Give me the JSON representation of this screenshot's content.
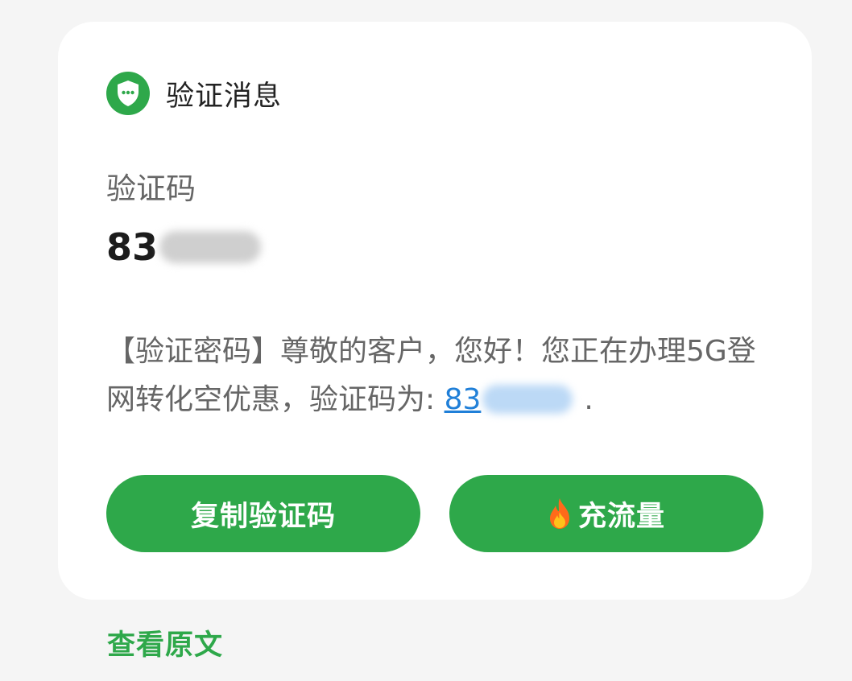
{
  "header": {
    "icon": "shield-chat-icon",
    "title": "验证消息"
  },
  "code": {
    "label": "验证码",
    "value_visible": "83"
  },
  "message": {
    "text": "【验证密码】尊敬的客户，您好！您正在办理5G登网转化空优惠，验证码为: ",
    "code_visible": "83",
    "suffix": "."
  },
  "buttons": {
    "copy_label": "复制验证码",
    "data_label": "充流量",
    "data_icon": "fire-icon"
  },
  "footer": {
    "view_original": "查看原文"
  },
  "colors": {
    "accent": "#2ea84a",
    "link": "#1f7fd8",
    "card": "#ffffff",
    "background": "#f5f5f5"
  }
}
